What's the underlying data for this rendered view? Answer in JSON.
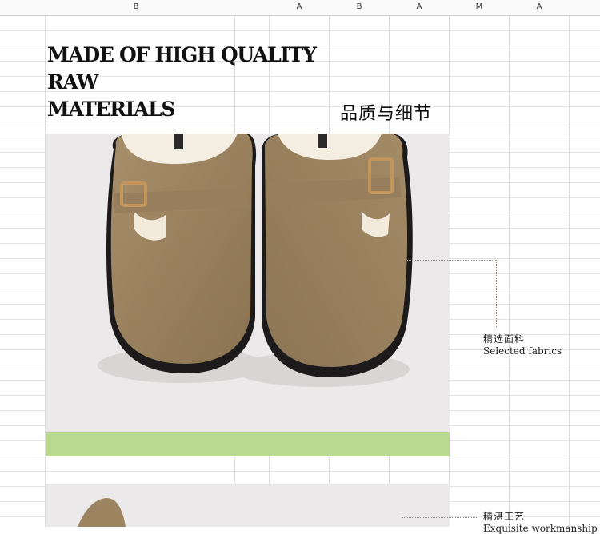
{
  "column_headers": [
    "B",
    "A",
    "B",
    "A",
    "M",
    "A"
  ],
  "heading_lines": [
    "MADE OF HIGH QUALITY",
    "RAW",
    "MATERIALS"
  ],
  "cn_title": "品质与细节",
  "callouts": [
    {
      "cn": "精选面料",
      "en": "Selected fabrics"
    },
    {
      "cn": "精湛工艺",
      "en": "Exquisite workmanship"
    }
  ],
  "colors": {
    "accent_green": "#b8d98e",
    "suede": "#9c8461",
    "photo_bg": "#ebe9ea"
  },
  "icons": [
    "clog-photo",
    "clog-photo-detail"
  ]
}
